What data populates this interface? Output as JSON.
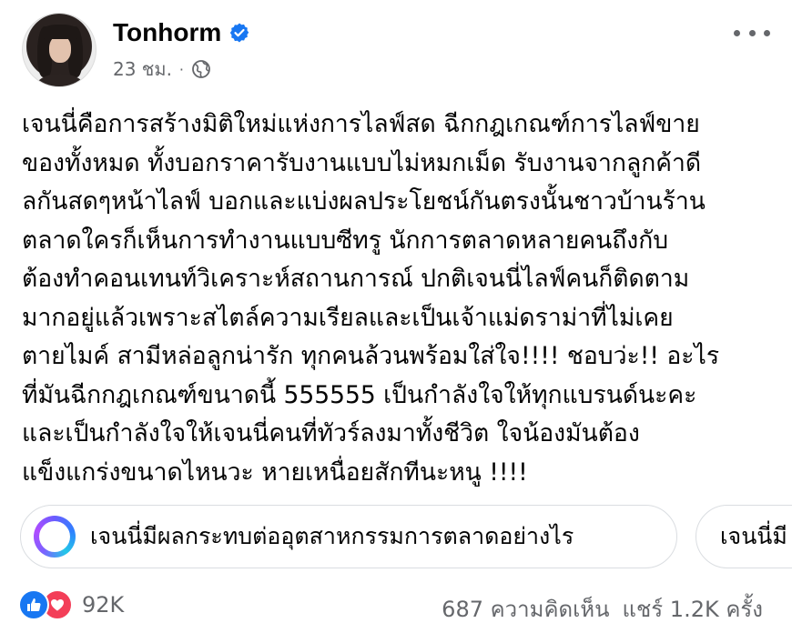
{
  "post": {
    "author": "Tonhorm",
    "time": "23 ชม.",
    "separator": "·",
    "icons": {
      "verified": "verified-badge-icon",
      "audience": "globe-icon",
      "menu": "more-options-icon"
    },
    "lines": [
      "เจนนี่คือการสร้างมิติใหม่แห่งการไลฟ์สด ฉีกกฎเกณฑ์การไลฟ์ขาย",
      "ของทั้งหมด ทั้งบอกราคารับงานแบบไม่หมกเม็ด รับงานจากลูกค้าดี",
      "ลกันสดๆหน้าไลฟ์ บอกและแบ่งผลประโยชน์กันตรงนั้นชาวบ้านร้าน",
      "ตลาดใครก็เห็นการทำงานแบบซีทรู นักการตลาดหลายคนถึงกับ",
      "ต้องทำคอนเทนท์วิเคราะห์สถานการณ์ ปกติเจนนี่ไลฟ์คนก็ติดตาม",
      "มากอยู่แล้วเพราะสไตล์ความเรียลและเป็นเจ้าแม่ดราม่าที่ไม่เคย",
      "ตายไมค์ สามีหล่อลูกน่ารัก ทุกคนล้วนพร้อมใส่ใจ!!!! ชอบว่ะ!! อะไร",
      "ที่มันฉีกกฎเกณฑ์ขนาดนี้ 555555 เป็นกำลังใจให้ทุกแบรนด์นะคะ",
      "และเป็นกำลังใจให้เจนนี่คนที่ทัวร์ลงมาทั้งชีวิต ใจน้องมันต้อง",
      "แข็งแกร่งขนาดไหนวะ  หายเหนื่อยสักทีนะหนู !!!!"
    ],
    "suggestions": [
      "เจนนี่มีผลกระทบต่ออุตสาหกรรมการตลาดอย่างไร",
      "เจนนี่มี"
    ],
    "reactions_count": "92K",
    "comments": "687 ความคิดเห็น",
    "shares": "แชร์ 1.2K ครั้ง",
    "colors": {
      "text": "#050505",
      "secondary": "#65676b",
      "verified": "#1877f2",
      "like": "#1877f2",
      "love": "#f33e58"
    }
  }
}
